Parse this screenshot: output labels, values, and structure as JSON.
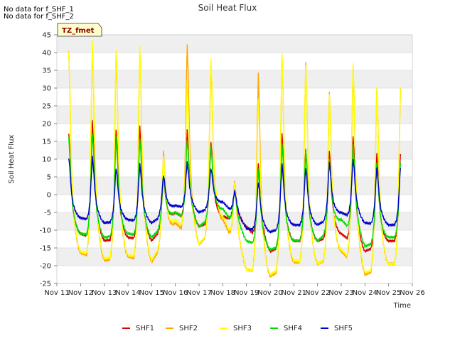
{
  "notes": [
    "No data for f_SHF_1",
    "No data for f_SHF_2"
  ],
  "chart_data": {
    "type": "line",
    "title": "Soil Heat Flux",
    "xlabel": "Time",
    "ylabel": "Soil Heat Flux",
    "badge": "TZ_fmet",
    "xlim": [
      "2024-11-11",
      "2024-11-26"
    ],
    "xtick_labels": [
      "Nov 11",
      "Nov 12",
      "Nov 13",
      "Nov 14",
      "Nov 15",
      "Nov 16",
      "Nov 17",
      "Nov 18",
      "Nov 19",
      "Nov 20",
      "Nov 21",
      "Nov 22",
      "Nov 23",
      "Nov 24",
      "Nov 25",
      "Nov 26"
    ],
    "ylim": [
      -25,
      45
    ],
    "yticks": [
      -25,
      -20,
      -15,
      -10,
      -5,
      0,
      5,
      10,
      15,
      20,
      25,
      30,
      35,
      40,
      45
    ],
    "grid": true,
    "legend_position": "bottom",
    "series": [
      {
        "name": "SHF1",
        "color": "#dd0000",
        "night": [
          -12,
          -11,
          -13,
          -12,
          -13,
          -5,
          -9,
          -6,
          -9,
          -16,
          -13,
          -13,
          -11,
          -16,
          -13
        ],
        "peak": [
          17.5,
          20.5,
          18.5,
          19,
          5,
          18,
          15,
          1.5,
          9,
          17,
          13,
          12,
          16.5,
          11.5
        ]
      },
      {
        "name": "SHF2",
        "color": "#ffa500",
        "night": [
          -18,
          -16.5,
          -18.5,
          -17.5,
          -19,
          -8,
          -14,
          -7,
          -21,
          -23,
          -19,
          -19.5,
          -16,
          -22.5,
          -19.5
        ],
        "peak": [
          40,
          42,
          40,
          41,
          12,
          42.5,
          37,
          4,
          34,
          39,
          37,
          29,
          36,
          30
        ]
      },
      {
        "name": "SHF3",
        "color": "#ffff00",
        "night": [
          -17,
          -16,
          -18,
          -17,
          -18.5,
          -7,
          -14,
          -6,
          -21,
          -22.5,
          -18.5,
          -19.5,
          -15.5,
          -22,
          -19.5
        ],
        "peak": [
          40.5,
          43,
          41,
          41.5,
          11,
          32,
          38.5,
          3,
          27,
          39.5,
          36.5,
          28,
          37,
          30
        ]
      },
      {
        "name": "SHF4",
        "color": "#00dd00",
        "night": [
          -11,
          -11,
          -12,
          -11,
          -12,
          -5,
          -9,
          -4,
          -13,
          -15.5,
          -13,
          -13,
          -7,
          -14.5,
          -12
        ],
        "peak": [
          16,
          17.5,
          16,
          16,
          5,
          15.5,
          13.5,
          1,
          7,
          14.5,
          12.5,
          10,
          14,
          9
        ]
      },
      {
        "name": "SHF5",
        "color": "#0000cc",
        "night": [
          -7.5,
          -6.5,
          -8,
          -7,
          -8,
          -3,
          -5,
          -2,
          -9.5,
          -10.5,
          -8.5,
          -8.5,
          -5,
          -8,
          -8.5
        ],
        "peak": [
          10.5,
          10.5,
          7.5,
          8.5,
          5.5,
          9,
          7.5,
          1,
          3.5,
          8.5,
          7.5,
          9,
          10,
          7.5
        ]
      }
    ]
  }
}
